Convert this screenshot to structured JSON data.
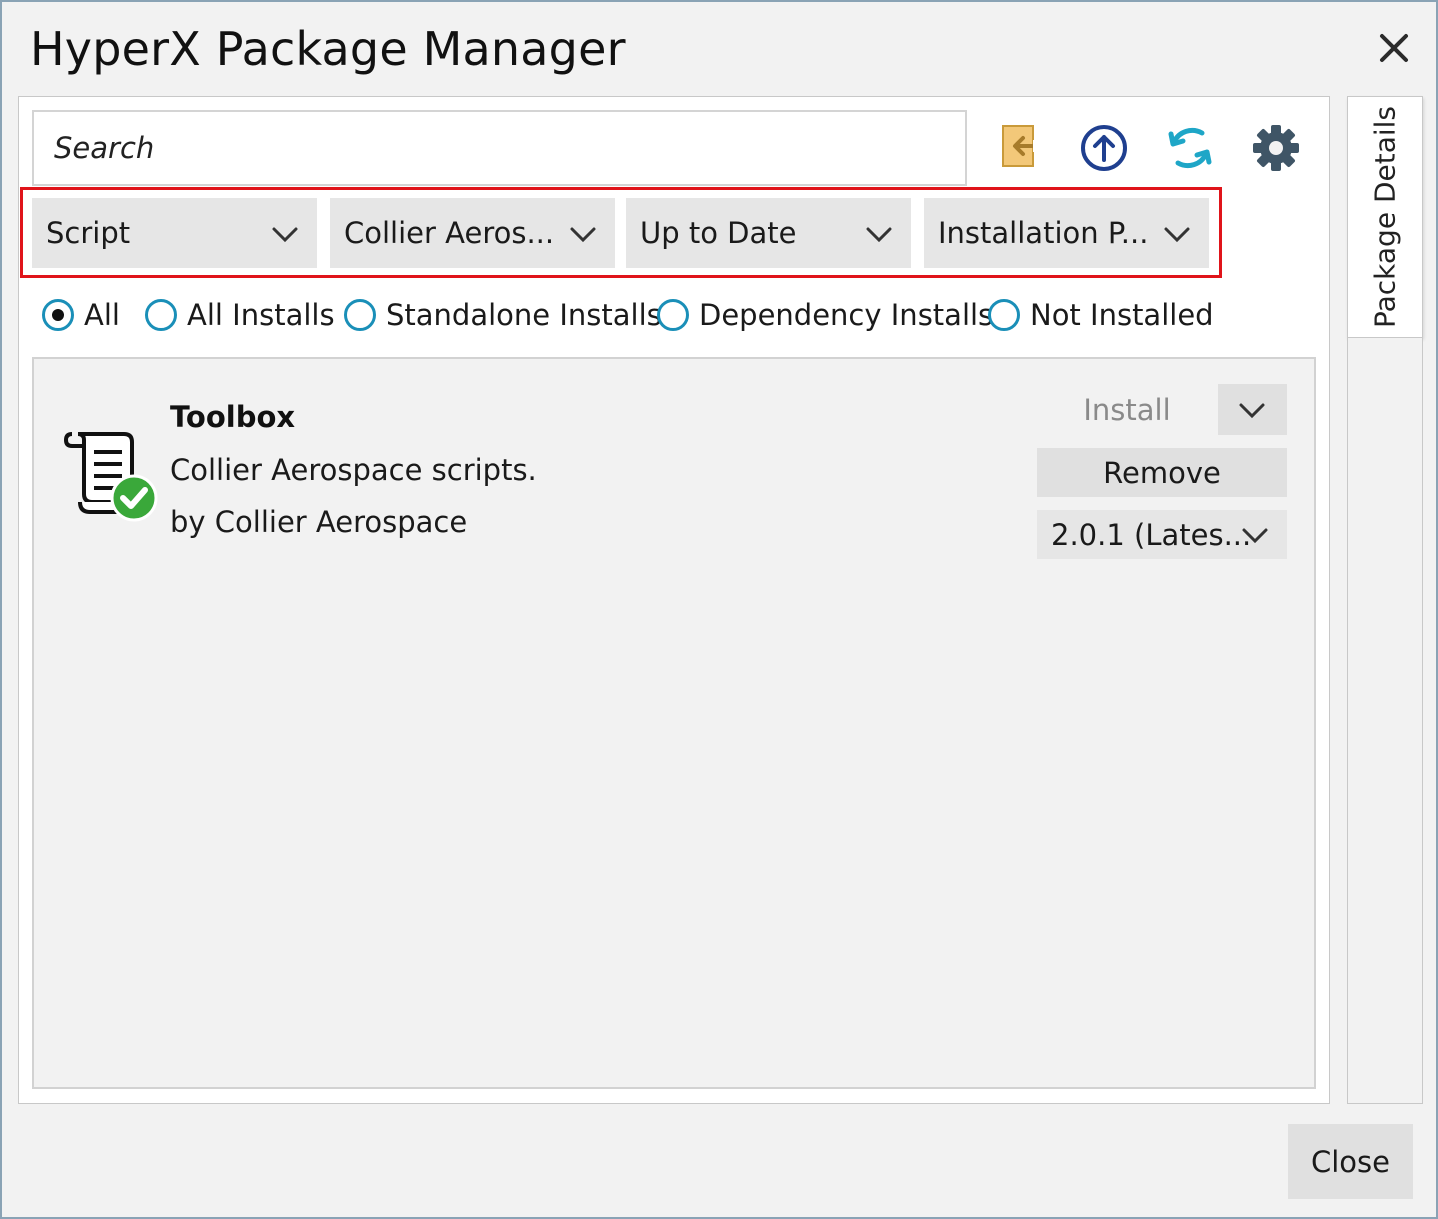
{
  "window": {
    "title": "HyperX Package Manager"
  },
  "search": {
    "placeholder": "Search"
  },
  "toolbar": {
    "icons": [
      "import-icon",
      "upload-icon",
      "refresh-icon",
      "settings-gear-icon"
    ]
  },
  "filters": [
    {
      "value": "Script"
    },
    {
      "value": "Collier Aeros..."
    },
    {
      "value": "Up to Date"
    },
    {
      "value": "Installation P..."
    }
  ],
  "install_filter": {
    "options": [
      "All",
      "All Installs",
      "Standalone Installs",
      "Dependency Installs",
      "Not Installed"
    ],
    "selected": "All"
  },
  "side_panel": {
    "label": "Package Details"
  },
  "packages": [
    {
      "name": "Toolbox",
      "description": "Collier Aerospace scripts.",
      "author": "by Collier Aerospace",
      "install_label": "Install",
      "remove_label": "Remove",
      "version": "2.0.1 (Lates..."
    }
  ],
  "footer": {
    "close_label": "Close"
  },
  "colors": {
    "accent": "#1a8fb8",
    "highlight_frame": "#e0141a",
    "check_green": "#3aa83a"
  }
}
